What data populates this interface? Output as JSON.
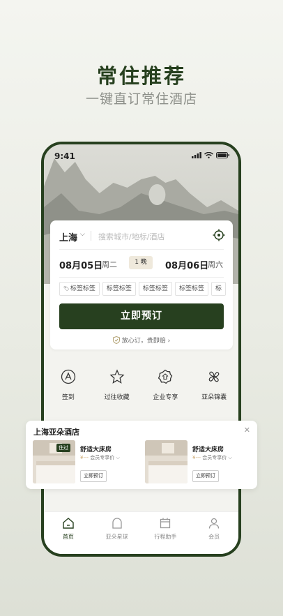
{
  "hero": {
    "title": "常住推荐",
    "subtitle": "一键直订常住酒店"
  },
  "status": {
    "time": "9:41"
  },
  "search": {
    "city": "上海",
    "placeholder": "搜索城市/地标/酒店",
    "checkin_date": "08月05日",
    "checkin_weekday": "周二",
    "nights": "1 晚",
    "checkout_date": "08月06日",
    "checkout_weekday": "周六",
    "tags": [
      "标签标签",
      "标签标签",
      "标签标签",
      "标签标签",
      "标"
    ],
    "book_label": "立即预订",
    "guarantee": "放心订，贵即赔"
  },
  "quick_actions": [
    {
      "label": "签到",
      "icon": "sign-in-icon"
    },
    {
      "label": "过往收藏",
      "icon": "star-icon"
    },
    {
      "label": "企业专享",
      "icon": "enterprise-badge-icon"
    },
    {
      "label": "亚朵锦囊",
      "icon": "clover-icon"
    }
  ],
  "tabs": [
    {
      "label": "首页",
      "icon": "home-icon",
      "active": true
    },
    {
      "label": "亚朵星球",
      "icon": "planet-icon",
      "active": false
    },
    {
      "label": "行程助手",
      "icon": "calendar-icon",
      "active": false
    },
    {
      "label": "会员",
      "icon": "user-icon",
      "active": false
    }
  ],
  "hotel_card": {
    "title": "上海亚朵酒店",
    "rooms": [
      {
        "name": "舒适大床房",
        "price": "¥---",
        "member_price": "会员专享价",
        "book": "立即预订",
        "badge": "住过"
      },
      {
        "name": "舒适大床房",
        "price": "¥---",
        "member_price": "会员专享价",
        "book": "立即预订"
      }
    ]
  },
  "colors": {
    "brand": "#27401f",
    "price": "#c9a46a"
  }
}
